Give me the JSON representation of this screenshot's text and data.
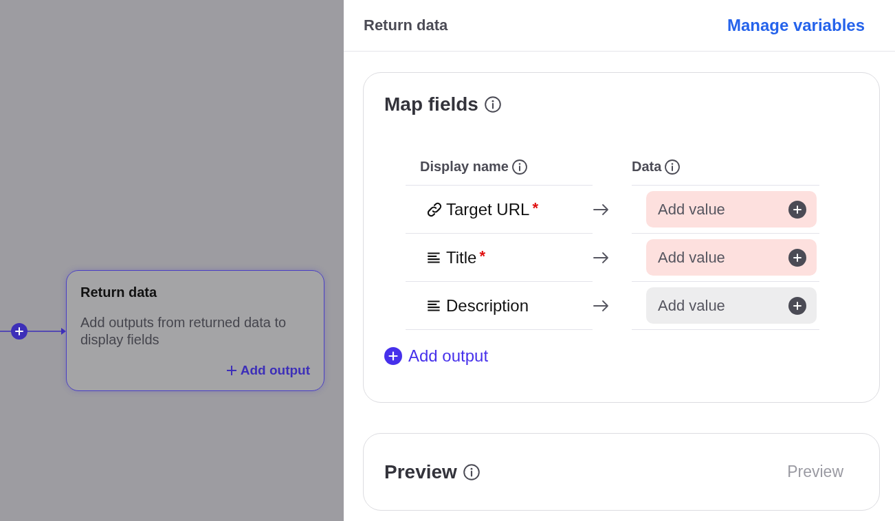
{
  "canvas": {
    "node": {
      "title": "Return data",
      "description": "Add outputs from returned data to display fields",
      "action": "Add output"
    }
  },
  "panel": {
    "title": "Return data",
    "link": "Manage variables"
  },
  "map_fields": {
    "title": "Map fields",
    "columns": [
      "Display name",
      "Data"
    ],
    "rows": [
      {
        "kind": "link",
        "name": "Target URL",
        "required": true,
        "required_mark": "*",
        "placeholder": "Add value"
      },
      {
        "kind": "text",
        "name": "Title",
        "required": true,
        "required_mark": "*",
        "placeholder": "Add value"
      },
      {
        "kind": "text",
        "name": "Description",
        "required": false,
        "placeholder": "Add value"
      }
    ],
    "add_button": "Add output"
  },
  "preview": {
    "title": "Preview",
    "button": "Preview"
  }
}
